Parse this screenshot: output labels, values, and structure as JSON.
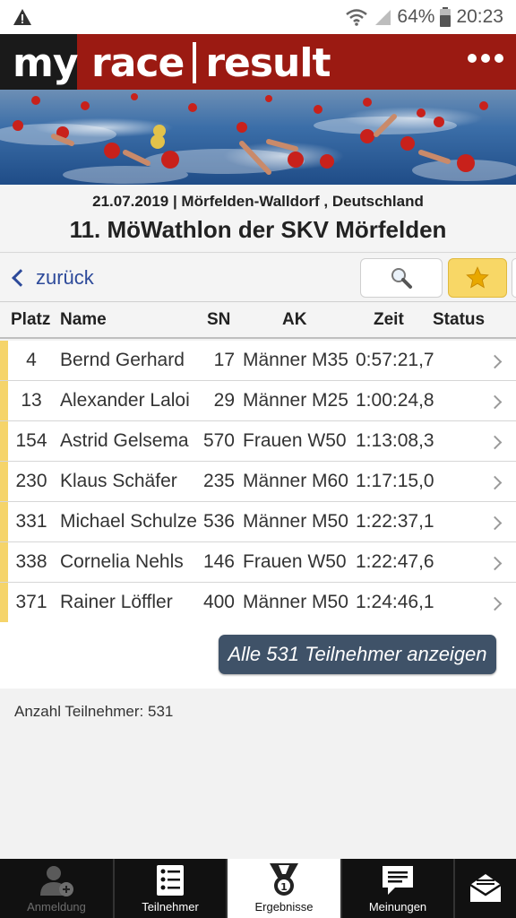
{
  "status_bar": {
    "battery": "64%",
    "time": "20:23"
  },
  "app": {
    "logo_part1": "my",
    "logo_part2": "race",
    "logo_part3": "result"
  },
  "event": {
    "date_location": "21.07.2019 | Mörfelden-Walldorf , Deutschland",
    "title": "11. MöWathlon der SKV Mörfelden"
  },
  "nav": {
    "back_label": "zurück"
  },
  "table": {
    "headers": {
      "platz": "Platz",
      "name": "Name",
      "sn": "SN",
      "ak": "AK",
      "zeit": "Zeit",
      "status": "Status"
    },
    "rows": [
      {
        "platz": "4",
        "name": "Bernd Gerhard",
        "sn": "17",
        "ak": "Männer M35",
        "zeit": "0:57:21,7"
      },
      {
        "platz": "13",
        "name": "Alexander Laloi",
        "sn": "29",
        "ak": "Männer M25",
        "zeit": "1:00:24,8"
      },
      {
        "platz": "154",
        "name": "Astrid Gelsema",
        "sn": "570",
        "ak": "Frauen W50",
        "zeit": "1:13:08,3"
      },
      {
        "platz": "230",
        "name": "Klaus Schäfer",
        "sn": "235",
        "ak": "Männer M60",
        "zeit": "1:17:15,0"
      },
      {
        "platz": "331",
        "name": "Michael Schulze",
        "sn": "536",
        "ak": "Männer M50",
        "zeit": "1:22:37,1"
      },
      {
        "platz": "338",
        "name": "Cornelia Nehls",
        "sn": "146",
        "ak": "Frauen W50",
        "zeit": "1:22:47,6"
      },
      {
        "platz": "371",
        "name": "Rainer Löffler",
        "sn": "400",
        "ak": "Männer M50",
        "zeit": "1:24:46,1"
      }
    ]
  },
  "all_button": "Alle 531 Teilnehmer anzeigen",
  "participant_count": "Anzahl Teilnehmer: 531",
  "tabs": [
    {
      "label": "Anmeldung",
      "icon": "user-add-icon",
      "state": "disabled"
    },
    {
      "label": "Teilnehmer",
      "icon": "participant-list-icon",
      "state": "normal"
    },
    {
      "label": "Ergebnisse",
      "icon": "medal-icon",
      "state": "active"
    },
    {
      "label": "Meinungen",
      "icon": "comment-icon",
      "state": "normal"
    },
    {
      "label": "",
      "icon": "mail-icon",
      "state": "normal"
    }
  ],
  "colors": {
    "header_red": "#9b1a12",
    "accent_yellow": "#f5d46a",
    "link_blue": "#2d4a9a",
    "button_slate": "#3f5268"
  }
}
